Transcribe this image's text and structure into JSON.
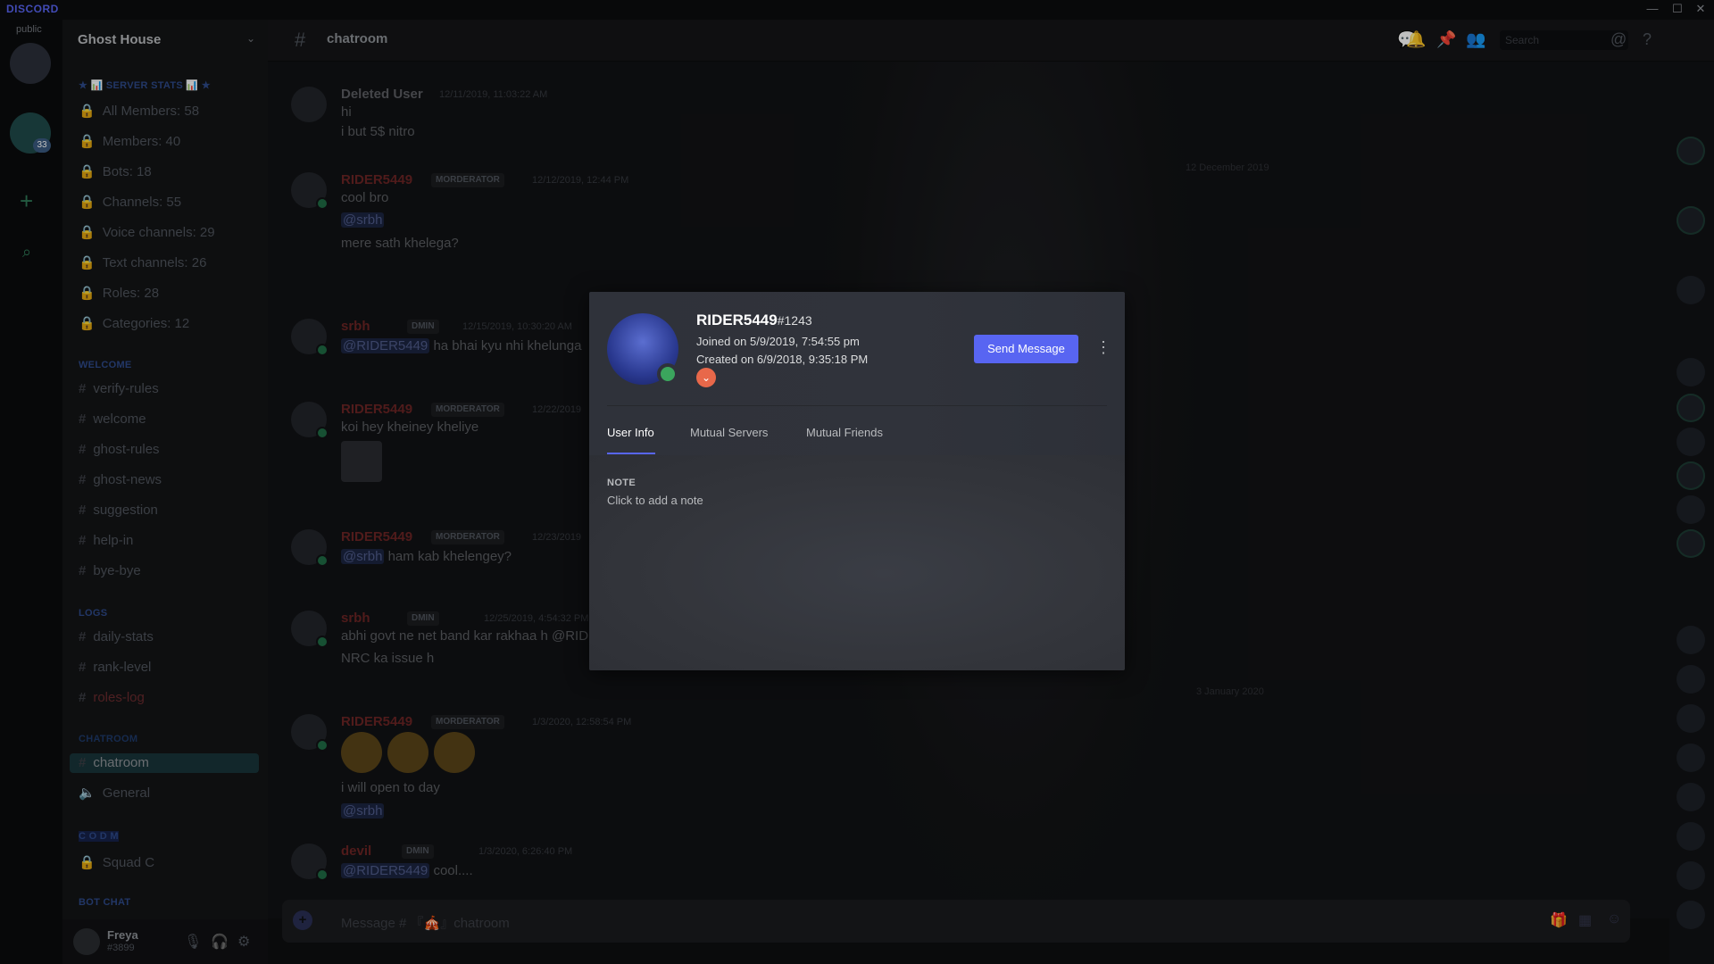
{
  "app": {
    "logo": "DISCORD",
    "rail_tag": "public",
    "rail_badge": "33"
  },
  "window": {
    "minimize": "—",
    "maximize": "☐",
    "close": "✕"
  },
  "server": {
    "name": "Ghost House"
  },
  "sidebar": {
    "cat_stats": "★ 📊 SERVER STATS 📊 ★",
    "stats": [
      "All Members: 58",
      "Members: 40",
      "Bots: 18",
      "Channels: 55",
      "Voice channels: 29",
      "Text channels: 26",
      "Roles: 28",
      "Categories: 12"
    ],
    "cat_welcome": "WELCOME",
    "welcome": [
      "verify-rules",
      "welcome",
      "ghost-rules",
      "ghost-news",
      "suggestion",
      "help-in",
      "bye-bye"
    ],
    "cat_logs": "LOGS",
    "logs": [
      "daily-stats",
      "rank-level",
      "roles-log"
    ],
    "cat_chat": "CHATROOM",
    "chatroom": "chatroom",
    "general": "General",
    "cat_code": "C O D M",
    "squad": "Squad C",
    "cat_bot": "BOT CHAT"
  },
  "user": {
    "name": "Freya",
    "disc": "#3899"
  },
  "header": {
    "channel": "chatroom",
    "search_placeholder": "Search"
  },
  "messages": {
    "m1": {
      "author": "Deleted User",
      "time": "12/11/2019, 11:03:22 AM",
      "l1": "hi",
      "l2": "i but 5$ nitro"
    },
    "m2": {
      "author": "RIDER5449",
      "tag": "MORDERATOR",
      "time": "12/12/2019, 12:44 PM",
      "l1": "cool bro",
      "mention": "@srbh",
      "l3": "mere sath khelega?"
    },
    "m3": {
      "author": "srbh",
      "tag": "DMIN",
      "time": "12/15/2019, 10:30:20 AM",
      "mention": "@RIDER5449",
      "text": "ha bhai kyu nhi khelunga"
    },
    "m4": {
      "author": "RIDER5449",
      "tag": "MORDERATOR",
      "time": "12/22/2019",
      "l1": "koi hey kheiney kheliye"
    },
    "m5": {
      "author": "RIDER5449",
      "tag": "MORDERATOR",
      "time": "12/23/2019",
      "mention": "@srbh",
      "text": "ham kab khelengey?"
    },
    "m6": {
      "author": "srbh",
      "tag": "DMIN",
      "time": "12/25/2019, 4:54:32 PM",
      "l1": "abhi govt ne net band kar rakhaa h @RIDE",
      "l2": "NRC ka issue h"
    },
    "m7": {
      "author": "RIDER5449",
      "tag": "MORDERATOR",
      "time": "1/3/2020, 12:58:54 PM",
      "l2": "i will open to day",
      "mention": "@srbh"
    },
    "m8": {
      "author": "devil",
      "tag": "DMIN",
      "time": "1/3/2020, 6:26:40 PM",
      "mention": "@RIDER5449",
      "text": "cool...."
    }
  },
  "dividers": {
    "d1": "12 December 2019",
    "d2": "3 January 2020"
  },
  "composer": {
    "placeholder": "Message # 『🎪』chatroom"
  },
  "profile": {
    "username": "RIDER5449",
    "discriminator": "#1243",
    "joined": "Joined on 5/9/2019, 7:54:55 pm",
    "created": "Created on 6/9/2018, 9:35:18 PM",
    "send_label": "Send Message",
    "more_label": "⋮",
    "tabs": [
      "User Info",
      "Mutual Servers",
      "Mutual Friends"
    ],
    "note_heading": "NOTE",
    "note_placeholder": "Click to add a note"
  },
  "colors": {
    "accent": "#5865f2",
    "online": "#3ba55d",
    "hypesquad": "#e8684a"
  }
}
